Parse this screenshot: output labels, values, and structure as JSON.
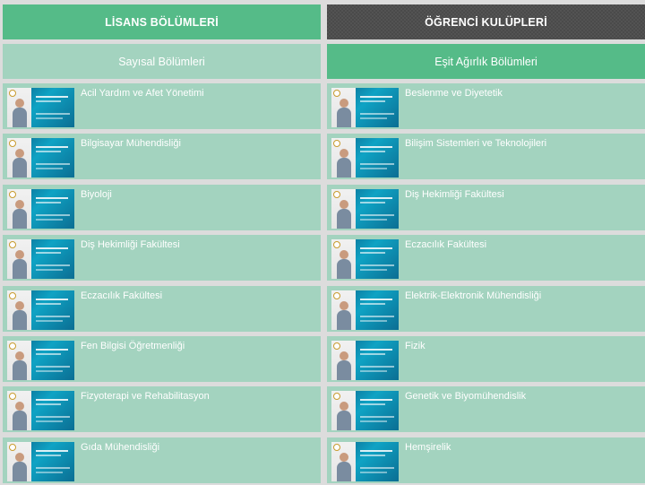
{
  "tabs": {
    "lisans": "LİSANS BÖLÜMLERİ",
    "kulupler": "ÖĞRENCİ KULÜPLERİ"
  },
  "subtabs": {
    "sayisal": "Sayısal Bölümleri",
    "esit": "Eşit Ağırlık Bölümleri"
  },
  "left_items": [
    {
      "title": "Acil Yardım ve Afet Yönetimi"
    },
    {
      "title": "Bilgisayar Mühendisliği"
    },
    {
      "title": "Biyoloji"
    },
    {
      "title": "Diş Hekimliği Fakültesi"
    },
    {
      "title": "Eczacılık Fakültesi"
    },
    {
      "title": "Fen Bilgisi Öğretmenliği"
    },
    {
      "title": "Fizyoterapi ve Rehabilitasyon"
    },
    {
      "title": "Gıda Mühendisliği"
    }
  ],
  "right_items": [
    {
      "title": "Beslenme ve Diyetetik"
    },
    {
      "title": "Bilişim Sistemleri ve Teknolojileri"
    },
    {
      "title": "Diş Hekimliği Fakültesi"
    },
    {
      "title": "Eczacılık Fakültesi"
    },
    {
      "title": "Elektrik-Elektronik Mühendisliği"
    },
    {
      "title": "Fizik"
    },
    {
      "title": "Genetik ve Biyomühendislik"
    },
    {
      "title": "Hemşirelik"
    }
  ],
  "colors": {
    "green": "#55bb88",
    "light_green": "#a3d3bf",
    "dark": "#4a4a4a"
  }
}
